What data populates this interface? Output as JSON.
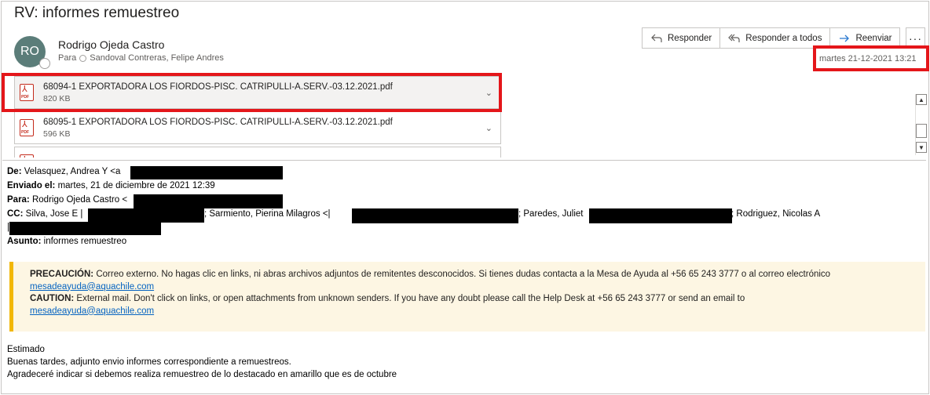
{
  "message": {
    "subject": "RV: informes remuestreo",
    "sender": {
      "initials": "RO",
      "name": "Rodrigo Ojeda Castro",
      "to_label": "Para",
      "to_name": "Sandoval Contreras, Felipe Andres"
    },
    "actions": {
      "reply": "Responder",
      "reply_all": "Responder a todos",
      "forward": "Reenviar",
      "more": "···"
    },
    "date": "martes 21-12-2021 13:21"
  },
  "attachments": [
    {
      "name": "68094-1 EXPORTADORA LOS FIORDOS-PISC. CATRIPULLI-A.SERV.-03.12.2021.pdf",
      "size": "820 KB",
      "icon": "pdf-icon"
    },
    {
      "name": "68095-1 EXPORTADORA LOS FIORDOS-PISC. CATRIPULLI-A.SERV.-03.12.2021.pdf",
      "size": "596 KB",
      "icon": "pdf-icon"
    },
    {
      "name": "",
      "size": "",
      "icon": "pdf-icon"
    }
  ],
  "forwarded_header": {
    "from_label": "De:",
    "from_value": "Velasquez, Andrea Y <a",
    "sent_label": "Enviado el:",
    "sent_value": "martes, 21 de diciembre de 2021 12:39",
    "to_label": "Para:",
    "to_value": "Rodrigo Ojeda Castro <",
    "cc_label": "CC:",
    "cc_part1": "Silva, Jose E |",
    "cc_part2": "; Sarmiento, Pierina Milagros <|",
    "cc_part3": "; Paredes, Juliet",
    "cc_part4": "; Rodriguez, Nicolas A",
    "cc_part5": "|",
    "subject_label": "Asunto:",
    "subject_value": "informes remuestreo"
  },
  "banner": {
    "es_label": "PRECAUCIÓN:",
    "es_text": " Correo externo. No hagas clic en links, ni abras archivos adjuntos de remitentes desconocidos. Si tienes dudas contacta a la Mesa de Ayuda al +56 65 243 3777 o al correo electrónico",
    "es_link": "mesadeayuda@aquachile.com",
    "en_label": "CAUTION:",
    "en_text": " External mail. Don't click on links, or open attachments from unknown senders. If you have any doubt please call the Help Desk at +56 65 243 3777 or send an email to",
    "en_link": "mesadeayuda@aquachile.com"
  },
  "body": {
    "line1": "Estimado",
    "line2": "Buenas tardes, adjunto envio informes correspondiente a remuestreos.",
    "line3": "Agradeceré indicar si debemos realiza remuestreo de lo destacado en amarillo que es de octubre"
  },
  "colors": {
    "highlight_box": "#e4161a",
    "banner_bg": "#fdf6e3",
    "banner_accent": "#f2b705",
    "link": "#0563c1",
    "avatar": "#5b7d79"
  }
}
